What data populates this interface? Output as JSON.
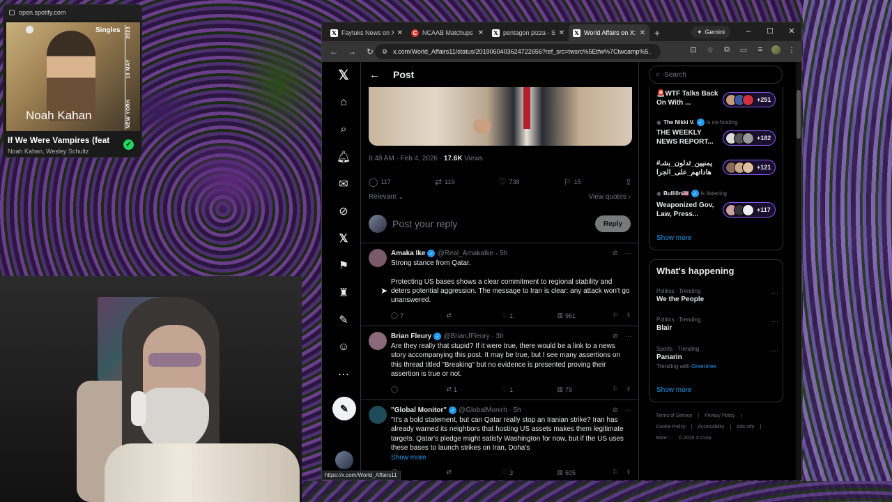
{
  "spotify": {
    "url": "open.spotify.com",
    "album_label": "Singles",
    "album_artist": "Noah Kahan",
    "side_text_top": "2023",
    "side_text_mid": "10 MAY",
    "side_text_bottom": "NEW YORK",
    "track_title": "If We Were Vampires (feat",
    "track_artists": "Noah Kahan, Wesley Schultz"
  },
  "browser": {
    "tabs": [
      {
        "title": "Faytuks News on X:",
        "favicon": "x-icon",
        "active": false
      },
      {
        "title": "NCAAB Matchups 2",
        "favicon": "c-icon",
        "active": false
      },
      {
        "title": "pentagon pizza - S",
        "favicon": "x-icon",
        "active": false
      },
      {
        "title": "World Affairs on X:",
        "favicon": "x-icon",
        "active": true
      }
    ],
    "gemini_label": "Gemini",
    "url": "x.com/World_Affairs11/status/2019060403624722656?ref_src=twsrc%5Etfw%7Ctwcamp%5...",
    "status_url": "https://x.com/World_Affairs11"
  },
  "post": {
    "header_title": "Post",
    "timestamp": "8:48 AM · Feb 4, 2026 · ",
    "views_count": "17.6K",
    "views_label": " Views",
    "replies": "117",
    "reposts": "119",
    "likes": "738",
    "bookmarks": "15",
    "relevant_label": "Relevant",
    "view_quotes_label": "View quotes",
    "reply_placeholder": "Post your reply",
    "reply_button": "Reply"
  },
  "replies": [
    {
      "name": "Amaka Ike",
      "handle": "@Real_AmakaIke · 5h",
      "text": "Strong stance from Qatar.\n\nProtecting US bases shows a clear commitment to regional stability and deters potential aggression. The message to Iran is clear: any attack won't go unanswered.",
      "show_more": "",
      "replies": "7",
      "reposts": "",
      "likes": "1",
      "views": "961",
      "avatar_color": "#7a5a66"
    },
    {
      "name": "Brian Fleury",
      "handle": "@BrianJFleury · 3h",
      "text": "Are they really that stupid? If it were true, there would be a link to a news story accompanying this post. It may be true, but I see many assertions on this thread titled \"Breaking\" but no evidence is presented proving their assertion is true or not.",
      "show_more": "",
      "replies": "",
      "reposts": "1",
      "likes": "1",
      "views": "79",
      "avatar_color": "#8a6a7a"
    },
    {
      "name": "\"Global Monitor\"",
      "handle": "@GlobalMonirh · 5h",
      "text": "\"It's a bold statement, but can Qatar really stop an Iranian strike? Iran has already warned its neighbors that hosting US assets makes them legitimate targets. Qatar's pledge might satisfy Washington for now, but if the US uses these bases to launch strikes on Iran, Doha's",
      "show_more": "Show more",
      "replies": "",
      "reposts": "",
      "likes": "3",
      "views": "605",
      "avatar_color": "#1f4a5a"
    }
  ],
  "sidebar": {
    "search_placeholder": "Search",
    "spaces": [
      {
        "host": "",
        "status": "",
        "title": "🚨WTF Talks Back On With ...",
        "count": "+251"
      },
      {
        "host": "The Nikki V.",
        "status": "is co-hosting",
        "title": "THE WEEKLY NEWS REPORT...",
        "count": "+182"
      },
      {
        "host": "",
        "status": "",
        "title": "#يمنيين_ثدلون_بشـ هاداتهم_على_الجرا",
        "count": "+121"
      },
      {
        "host": "Bulli0n🇺🇸",
        "status": "is listening",
        "title": "Weaponized Gov, Law, Press...",
        "count": "+117"
      }
    ],
    "spaces_show_more": "Show more",
    "happening_title": "What's happening",
    "trends": [
      {
        "category": "Politics · Trending",
        "name": "We the People",
        "extra_prefix": "",
        "extra_link": ""
      },
      {
        "category": "Politics · Trending",
        "name": "Blair",
        "extra_prefix": "",
        "extra_link": ""
      },
      {
        "category": "Sports · Trending",
        "name": "Panarin",
        "extra_prefix": "Trending with ",
        "extra_link": "Greentree"
      }
    ],
    "trends_show_more": "Show more",
    "footer": [
      "Terms of Service",
      "|",
      "Privacy Policy",
      "|",
      "Cookie Policy",
      "|",
      "Accessibility",
      "|",
      "Ads info",
      "|",
      "More ···",
      "© 2026 X Corp."
    ]
  },
  "colors": {
    "x_blue": "#1d9bf0",
    "spaces_purple": "#8a5cf6",
    "spotify_green": "#1ed760"
  }
}
